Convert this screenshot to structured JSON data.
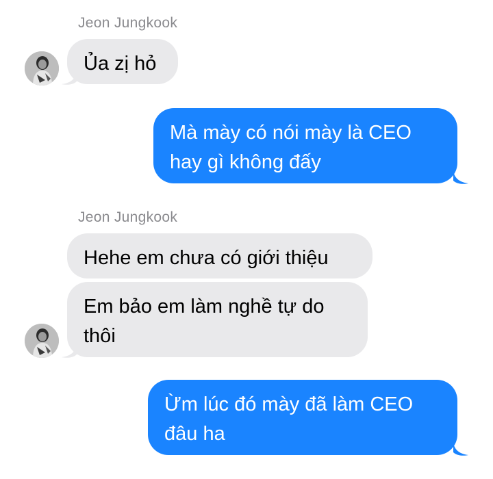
{
  "conversation": {
    "group1": {
      "sender": "Jeon Jungkook",
      "msg1": "Ủa zị hỏ"
    },
    "out1": {
      "line1": "Mà mày có nói mày là CEO",
      "line2": "hay gì không đấy"
    },
    "group2": {
      "sender": "Jeon Jungkook",
      "msg1": "Hehe em chưa có giới thiệu",
      "msg2_line1": "Em bảo em làm nghề tự do",
      "msg2_line2": "thôi"
    },
    "out2": {
      "line1": "Ừm lúc đó mày đã làm CEO",
      "line2": "đâu ha"
    }
  },
  "colors": {
    "incoming_bubble": "#e9e9eb",
    "outgoing_bubble": "#1a84ff",
    "sender_name": "#8a8a8e"
  },
  "icons": {
    "avatar": "contact-avatar-photo"
  }
}
